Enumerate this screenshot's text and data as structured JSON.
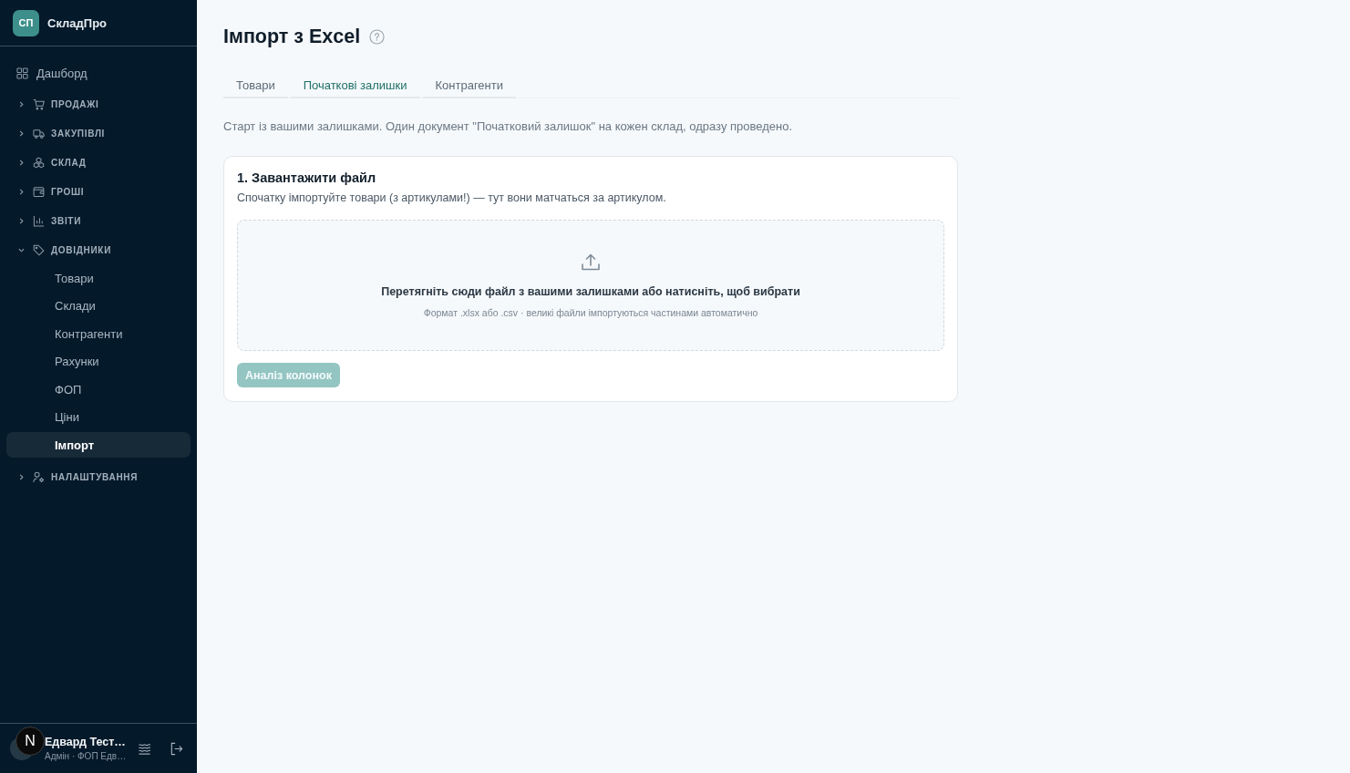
{
  "sidebar": {
    "logo": {
      "initials": "СП",
      "name": "СкладПро"
    },
    "nav": [
      {
        "kind": "link",
        "label": "Дашборд",
        "selected": false
      },
      {
        "kind": "section",
        "label": "ПРОДАЖІ",
        "expanded": false
      },
      {
        "kind": "section",
        "label": "ЗАКУПІВЛІ",
        "expanded": false
      },
      {
        "kind": "section",
        "label": "СКЛАД",
        "expanded": false
      },
      {
        "kind": "section",
        "label": "ГРОШІ",
        "expanded": false
      },
      {
        "kind": "section",
        "label": "ЗВІТИ",
        "expanded": false
      },
      {
        "kind": "section",
        "label": "ДОВІДНИКИ",
        "expanded": true,
        "children": [
          {
            "label": "Товари",
            "selected": false
          },
          {
            "label": "Склади",
            "selected": false
          },
          {
            "label": "Контрагенти",
            "selected": false
          },
          {
            "label": "Рахунки",
            "selected": false
          },
          {
            "label": "ФОП",
            "selected": false
          },
          {
            "label": "Ціни",
            "selected": false
          },
          {
            "label": "Імпорт",
            "selected": true
          }
        ]
      },
      {
        "kind": "section",
        "label": "НАЛАШТУВАННЯ",
        "expanded": false
      }
    ],
    "user": {
      "name": "Едвард Тест…",
      "role": "Адмін · ФОП Едв…"
    }
  },
  "dev_badge": {
    "label": "N"
  },
  "main": {
    "title": "Імпорт з Excel",
    "tabs": [
      {
        "label": "Товари",
        "selected": false
      },
      {
        "label": "Початкові залишки",
        "selected": true
      },
      {
        "label": "Контрагенти",
        "selected": false
      }
    ],
    "description": "Старт із вашими залишками. Один документ \"Початковий залишок\" на кожен склад, одразу проведено.",
    "card": {
      "title": "1. Завантажити файл",
      "subtitle": "Спочатку імпортуйте товари (з артикулами!) — тут вони матчаться за артикулом.",
      "dropzone": {
        "text": "Перетягніть сюди файл з вашими залишками або натисніть, щоб вибрати",
        "hint": "Формат .xlsx або .csv · великі файли імпортуються частинами автоматично"
      },
      "button": {
        "label": "Аналіз колонок",
        "disabled": true
      }
    }
  }
}
